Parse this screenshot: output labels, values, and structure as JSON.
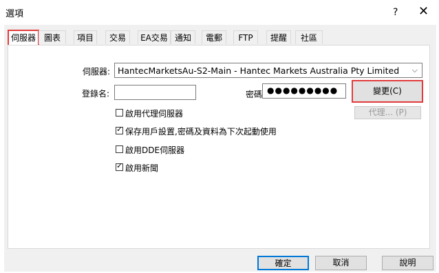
{
  "window": {
    "title": "選項",
    "help_label": "?",
    "close_label": "✕"
  },
  "tabs": [
    {
      "label": "伺服器"
    },
    {
      "label": "圖表"
    },
    {
      "label": "項目"
    },
    {
      "label": "交易"
    },
    {
      "label": "EA交易"
    },
    {
      "label": "通知"
    },
    {
      "label": "電郵"
    },
    {
      "label": "FTP"
    },
    {
      "label": "提醒"
    },
    {
      "label": "社區"
    }
  ],
  "server": {
    "server_label": "伺服器:",
    "server_value": "HantecMarketsAu-S2-Main - Hantec Markets Australia Pty Limited",
    "login_label": "登錄名:",
    "login_value": "",
    "password_label": "密碼:",
    "password_value": "●●●●●●●●●",
    "change_button": "變更(C)",
    "proxy_button": "代理... (P)"
  },
  "checkboxes": [
    {
      "label": "啟用代理伺服器",
      "checked": false
    },
    {
      "label": "保存用戶設置,密碼及資料為下次起動使用",
      "checked": true
    },
    {
      "label": "啟用DDE伺服器",
      "checked": false
    },
    {
      "label": "啟用新聞",
      "checked": true
    }
  ],
  "footer": {
    "ok": "確定",
    "cancel": "取消",
    "help": "說明"
  },
  "colors": {
    "highlight": "#e23b3b",
    "accent": "#0078d7"
  }
}
